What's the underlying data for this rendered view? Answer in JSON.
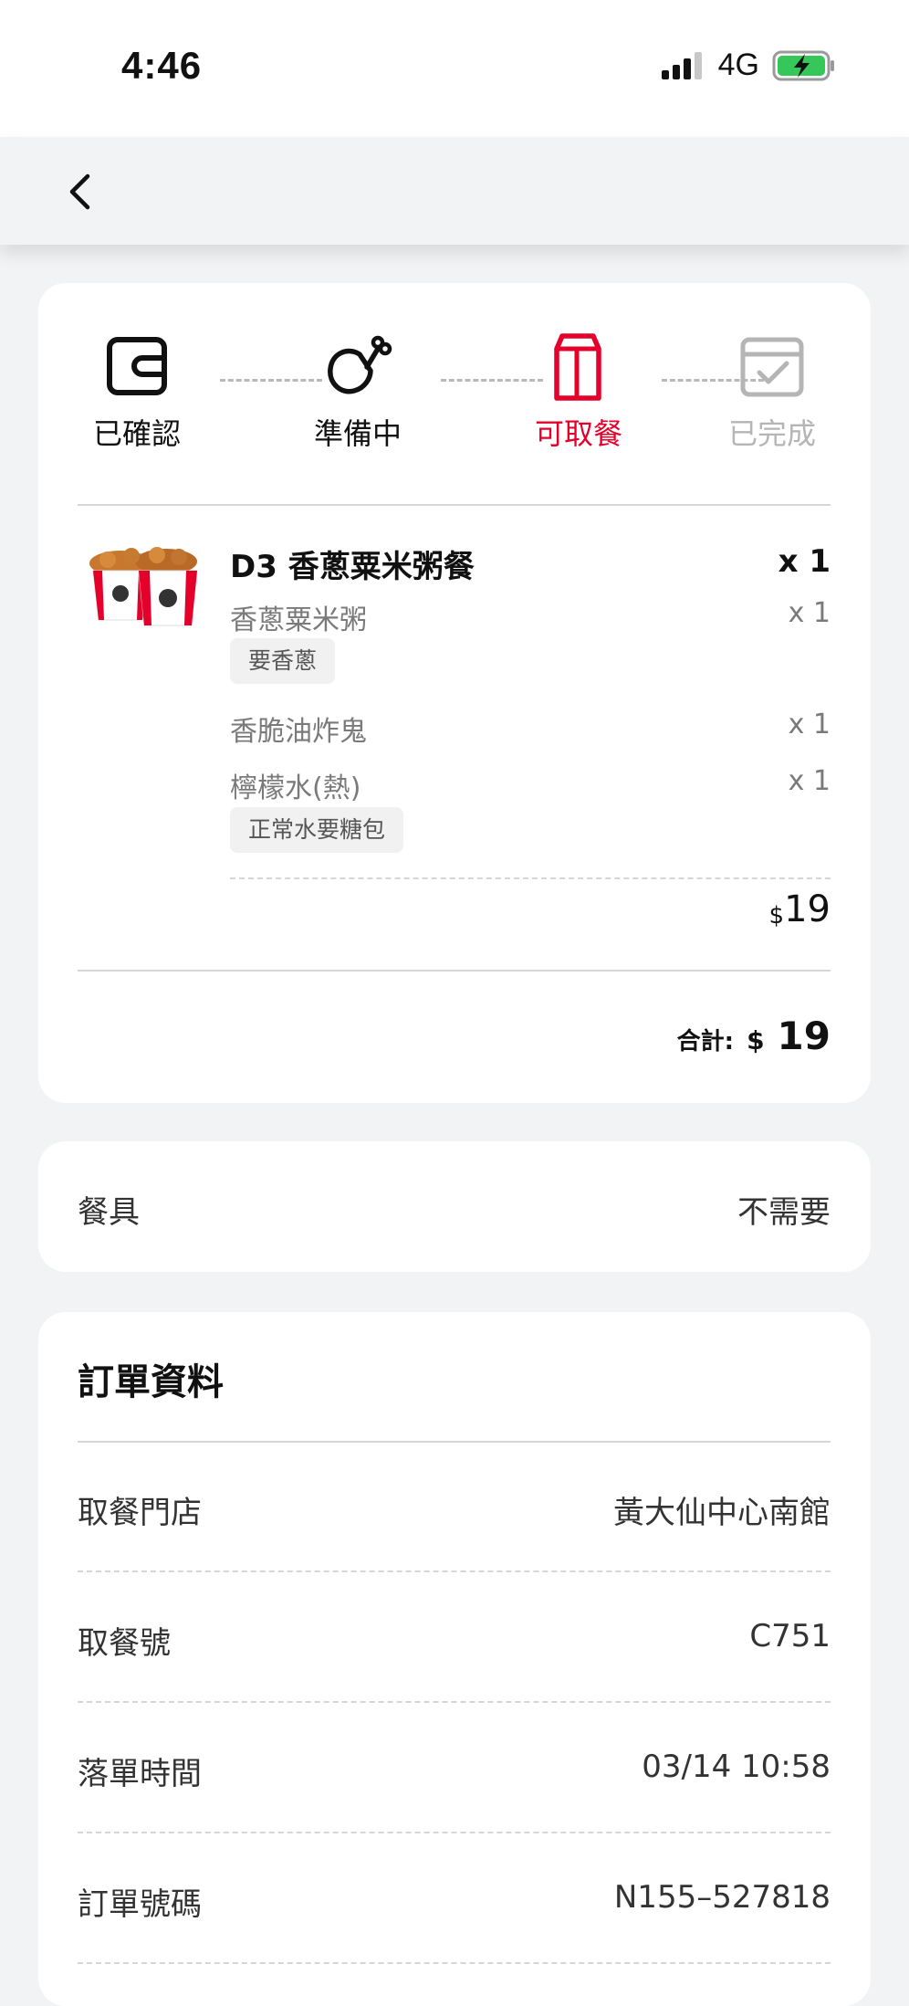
{
  "status_bar": {
    "time": "4:46",
    "network": "4G"
  },
  "nav": {
    "back_icon": "chevron-left-icon"
  },
  "order_status": {
    "steps": [
      {
        "label": "已確認",
        "icon": "wallet-icon",
        "state": "done"
      },
      {
        "label": "準備中",
        "icon": "drumstick-icon",
        "state": "done"
      },
      {
        "label": "可取餐",
        "icon": "bag-icon",
        "state": "current"
      },
      {
        "label": "已完成",
        "icon": "calendar-check-icon",
        "state": "pending"
      }
    ],
    "colors": {
      "active": "#111111",
      "current": "#e4002b",
      "pending": "#b5b5b5"
    }
  },
  "item": {
    "name": "D3 香蔥粟米粥餐",
    "qty": "x 1",
    "components": [
      {
        "name": "香蔥粟米粥",
        "qty": "x 1",
        "tag": "要香蔥"
      },
      {
        "name": "香脆油炸鬼",
        "qty": "x 1",
        "tag": ""
      },
      {
        "name": "檸檬水(熱)",
        "qty": "x 1",
        "tag": "正常水要糖包"
      }
    ],
    "price_currency": "$",
    "price": "19"
  },
  "summary": {
    "total_label": "合計:",
    "currency": "$",
    "total": "19"
  },
  "utensils": {
    "label": "餐具",
    "value": "不需要"
  },
  "order_info": {
    "title": "訂單資料",
    "rows": [
      {
        "label": "取餐門店",
        "value": "黃大仙中心南館"
      },
      {
        "label": "取餐號",
        "value": "C751"
      },
      {
        "label": "落單時間",
        "value": "03/14 10:58"
      },
      {
        "label": "訂單號碼",
        "value": "N155–527818"
      }
    ]
  }
}
